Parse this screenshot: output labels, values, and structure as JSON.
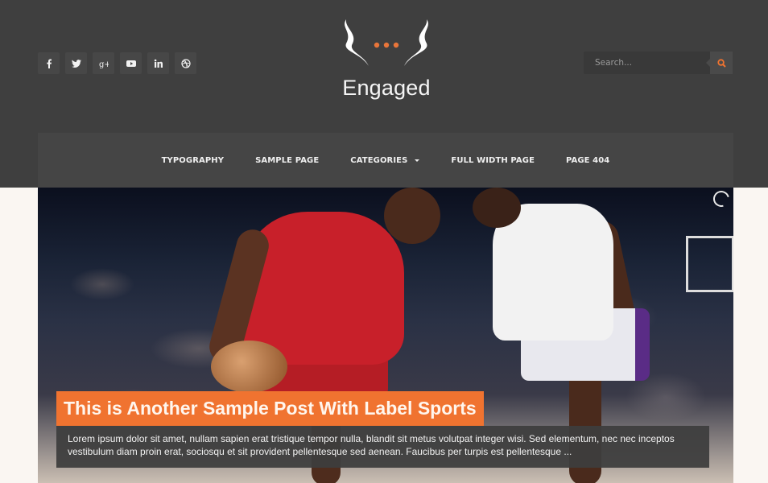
{
  "header": {
    "brand": {
      "title": "Engaged",
      "accent": "#e8753a"
    },
    "social": [
      {
        "name": "facebook",
        "icon": "facebook-icon"
      },
      {
        "name": "twitter",
        "icon": "twitter-icon"
      },
      {
        "name": "google-plus",
        "icon": "google-plus-icon"
      },
      {
        "name": "youtube",
        "icon": "youtube-icon"
      },
      {
        "name": "linkedin",
        "icon": "linkedin-icon"
      },
      {
        "name": "dribbble",
        "icon": "dribbble-icon"
      }
    ],
    "search": {
      "placeholder": "Search...",
      "value": "",
      "icon": "search-icon"
    }
  },
  "nav": {
    "items": [
      {
        "label": "Typography"
      },
      {
        "label": "Sample Page"
      },
      {
        "label": "Categories",
        "has_dropdown": true
      },
      {
        "label": "Full Width Page"
      },
      {
        "label": "Page 404"
      }
    ]
  },
  "slider": {
    "loading_icon": "spinner-icon",
    "post": {
      "title": "This is Another Sample Post With Label Sports",
      "excerpt": "Lorem ipsum dolor sit amet, nullam sapien erat tristique tempor nulla, blandit sit metus volutpat integer wisi. Sed elementum, nec nec inceptos vestibulum diam proin erat, sociosqu et sit provident pellentesque sed aenean. Faucibus per turpis est pellentesque ..."
    }
  },
  "colors": {
    "header_bg": "#3f3f3f",
    "nav_bg": "#454545",
    "accent": "#f07330",
    "page_bg": "#faf6f2"
  }
}
